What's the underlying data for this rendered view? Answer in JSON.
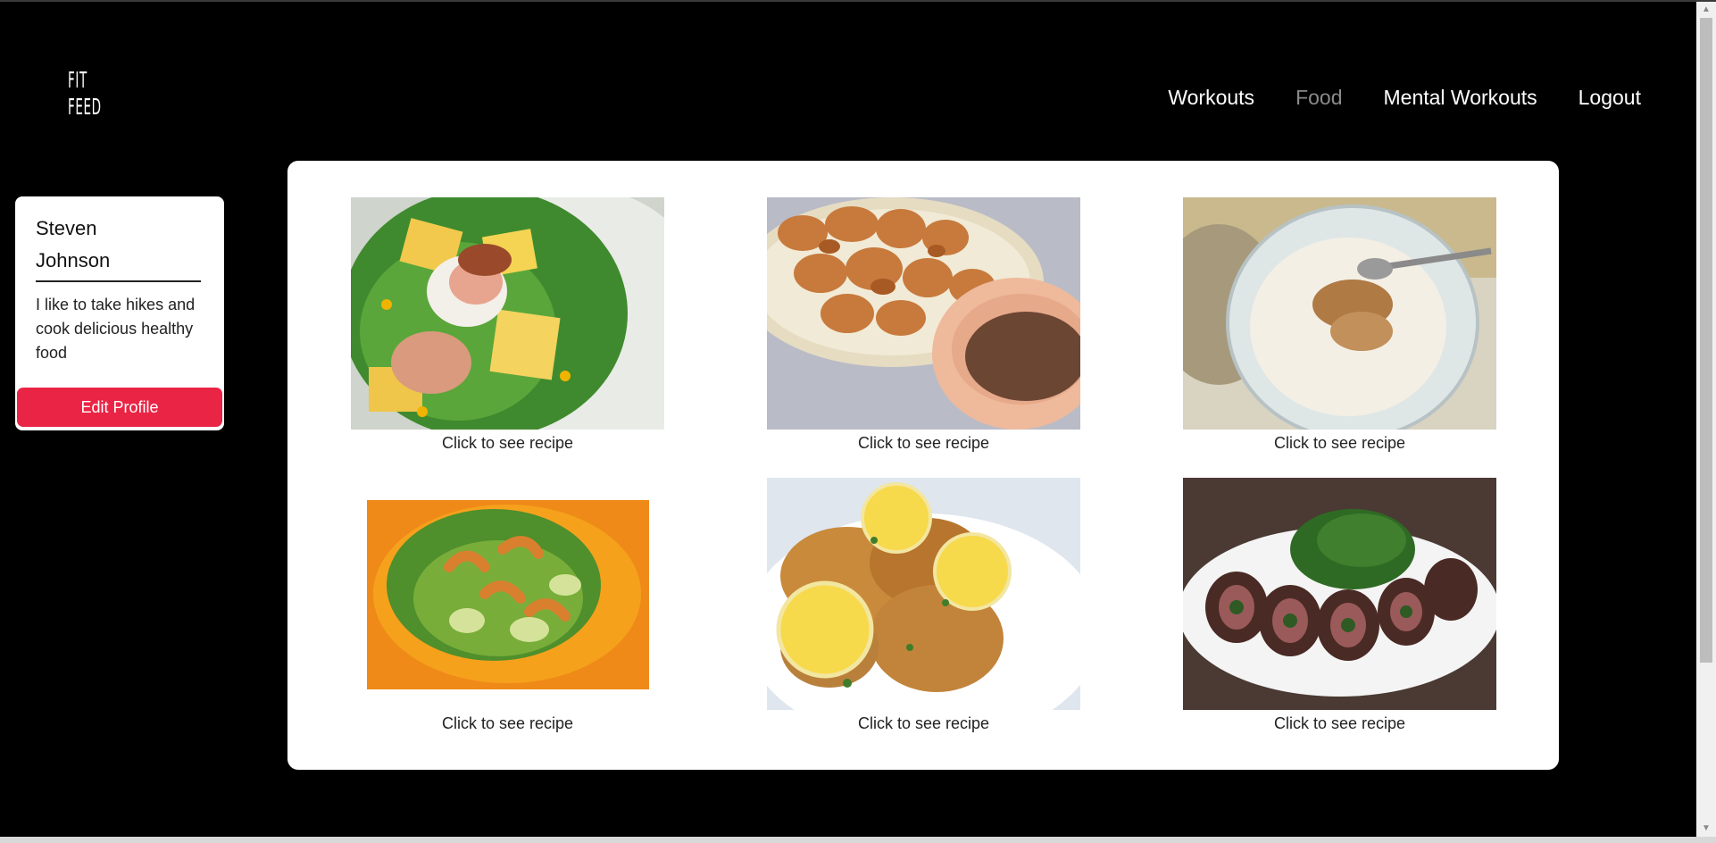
{
  "logo": {
    "line1": "FIT",
    "line2": "FEED"
  },
  "nav": {
    "items": [
      {
        "label": "Workouts",
        "active": false
      },
      {
        "label": "Food",
        "active": true
      },
      {
        "label": "Mental Workouts",
        "active": false
      },
      {
        "label": "Logout",
        "active": false
      }
    ]
  },
  "profile": {
    "first_name": "Steven",
    "last_name": "Johnson",
    "bio": "I like to take hikes and cook delicious healthy food",
    "edit_label": "Edit Profile"
  },
  "foods": [
    {
      "caption": "Click to see recipe",
      "image": "scallop-mango-salad"
    },
    {
      "caption": "Click to see recipe",
      "image": "grilled-chicken-bites-with-sauce"
    },
    {
      "caption": "Click to see recipe",
      "image": "rice-pudding-with-cinnamon"
    },
    {
      "caption": "Click to see recipe",
      "image": "shrimp-avocado-salad"
    },
    {
      "caption": "Click to see recipe",
      "image": "lemon-chicken-thighs"
    },
    {
      "caption": "Click to see recipe",
      "image": "stuffed-beef-tenderloin-with-spinach"
    }
  ],
  "colors": {
    "background": "#000000",
    "accent": "#ea2444",
    "nav_active": "#8a8a8a"
  }
}
